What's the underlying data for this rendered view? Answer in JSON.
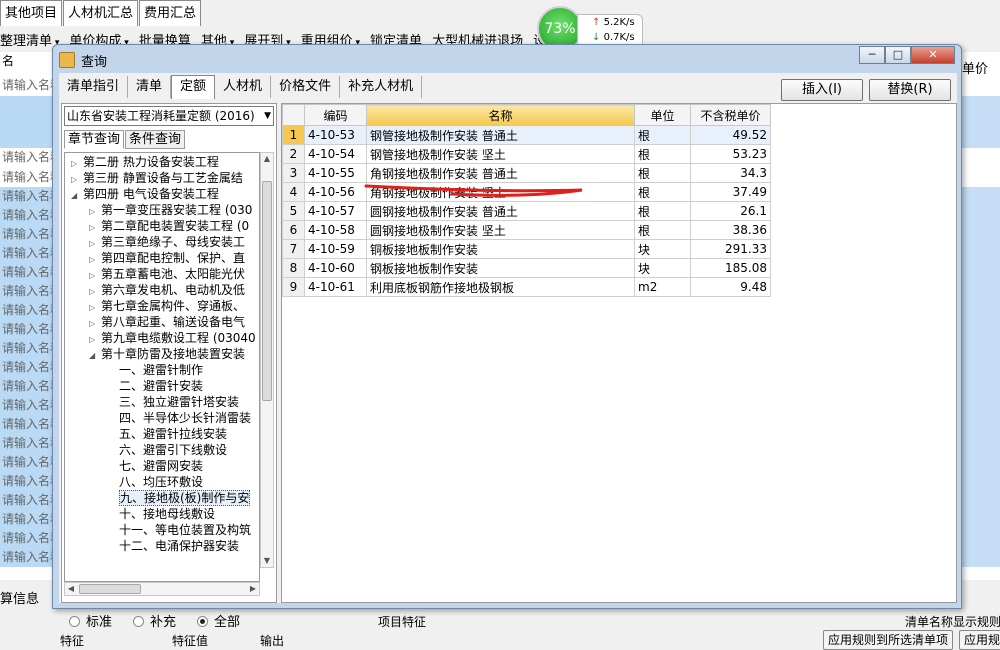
{
  "background": {
    "tabs": [
      "其他项目",
      "人材机汇总",
      "费用汇总"
    ],
    "toolbar": [
      "整理清单",
      "单价构成",
      "批量换算",
      "其他",
      "展开到",
      "重用组价",
      "锁定清单",
      "大型机械进退场",
      "设置"
    ],
    "row_text": "请输入名称",
    "right_header": "单价",
    "bottom_left_label": "算信息",
    "bottom_col_feature": "特征",
    "bottom_col_value": "特征值",
    "bottom_col_output": "输出",
    "bottom_center_label": "项目特征",
    "bottom_right_label": "清单名称显示规则",
    "bottom_btn_apply": "应用规则到所选清单项",
    "bottom_btn_apply2": "应用规则"
  },
  "net_widget": {
    "percent": "73%",
    "up": "5.2K/s",
    "down": "0.7K/s"
  },
  "dialog": {
    "title": "查询",
    "window_buttons": {
      "minimize": "─",
      "maximize": "□",
      "close": "✕"
    },
    "tabs": [
      {
        "label": "清单指引",
        "active": false
      },
      {
        "label": "清单",
        "active": false
      },
      {
        "label": "定额",
        "active": true
      },
      {
        "label": "人材机",
        "active": false
      },
      {
        "label": "价格文件",
        "active": false
      },
      {
        "label": "补充人材机",
        "active": false
      }
    ],
    "insert_button": "插入(I)",
    "replace_button": "替换(R)",
    "quota_library": "山东省安装工程消耗量定额 (2016)",
    "subtabs": [
      "章节查询",
      "条件查询"
    ],
    "tree": [
      {
        "level": 0,
        "toggle": "▷",
        "label": "第二册 热力设备安装工程"
      },
      {
        "level": 0,
        "toggle": "▷",
        "label": "第三册 静置设备与工艺金属结"
      },
      {
        "level": 0,
        "toggle": "◢",
        "label": "第四册 电气设备安装工程"
      },
      {
        "level": 1,
        "toggle": "▷",
        "label": "第一章变压器安装工程 (030"
      },
      {
        "level": 1,
        "toggle": "▷",
        "label": "第二章配电装置安装工程 (0"
      },
      {
        "level": 1,
        "toggle": "▷",
        "label": "第三章绝缘子、母线安装工"
      },
      {
        "level": 1,
        "toggle": "▷",
        "label": "第四章配电控制、保护、直"
      },
      {
        "level": 1,
        "toggle": "▷",
        "label": "第五章蓄电池、太阳能光伏"
      },
      {
        "level": 1,
        "toggle": "▷",
        "label": "第六章发电机、电动机及低"
      },
      {
        "level": 1,
        "toggle": "▷",
        "label": "第七章金属构件、穿通板、"
      },
      {
        "level": 1,
        "toggle": "▷",
        "label": "第八章起重、输送设备电气"
      },
      {
        "level": 1,
        "toggle": "▷",
        "label": "第九章电缆敷设工程 (03040"
      },
      {
        "level": 1,
        "toggle": "◢",
        "label": "第十章防雷及接地装置安装"
      },
      {
        "level": 2,
        "toggle": "",
        "label": "一、避雷针制作"
      },
      {
        "level": 2,
        "toggle": "",
        "label": "二、避雷针安装"
      },
      {
        "level": 2,
        "toggle": "",
        "label": "三、独立避雷针塔安装"
      },
      {
        "level": 2,
        "toggle": "",
        "label": "四、半导体少长针消雷装"
      },
      {
        "level": 2,
        "toggle": "",
        "label": "五、避雷针拉线安装"
      },
      {
        "level": 2,
        "toggle": "",
        "label": "六、避雷引下线敷设"
      },
      {
        "level": 2,
        "toggle": "",
        "label": "七、避雷网安装"
      },
      {
        "level": 2,
        "toggle": "",
        "label": "八、均压环敷设"
      },
      {
        "level": 2,
        "toggle": "",
        "label": "九、接地极(板)制作与安",
        "selected": true
      },
      {
        "level": 2,
        "toggle": "",
        "label": "十、接地母线敷设"
      },
      {
        "level": 2,
        "toggle": "",
        "label": "十一、等电位装置及构筑"
      },
      {
        "level": 2,
        "toggle": "",
        "label": "十二、电涌保护器安装"
      }
    ],
    "radio_options": [
      {
        "label": "标准",
        "checked": false
      },
      {
        "label": "补充",
        "checked": false
      },
      {
        "label": "全部",
        "checked": true
      }
    ],
    "table": {
      "columns": [
        "",
        "编码",
        "名称",
        "单位",
        "不含税单价"
      ],
      "rows": [
        {
          "n": "1",
          "code": "4-10-53",
          "name": "钢管接地极制作安装 普通土",
          "unit": "根",
          "price": "49.52"
        },
        {
          "n": "2",
          "code": "4-10-54",
          "name": "钢管接地极制作安装 坚土",
          "unit": "根",
          "price": "53.23"
        },
        {
          "n": "3",
          "code": "4-10-55",
          "name": "角钢接地极制作安装 普通土",
          "unit": "根",
          "price": "34.3"
        },
        {
          "n": "4",
          "code": "4-10-56",
          "name": "角钢接地极制作安装 坚土",
          "unit": "根",
          "price": "37.49"
        },
        {
          "n": "5",
          "code": "4-10-57",
          "name": "圆钢接地极制作安装 普通土",
          "unit": "根",
          "price": "26.1"
        },
        {
          "n": "6",
          "code": "4-10-58",
          "name": "圆钢接地极制作安装 坚土",
          "unit": "根",
          "price": "38.36"
        },
        {
          "n": "7",
          "code": "4-10-59",
          "name": "铜板接地板制作安装",
          "unit": "块",
          "price": "291.33"
        },
        {
          "n": "8",
          "code": "4-10-60",
          "name": "钢板接地板制作安装",
          "unit": "块",
          "price": "185.08"
        },
        {
          "n": "9",
          "code": "4-10-61",
          "name": "利用底板钢筋作接地极钢板",
          "unit": "m2",
          "price": "9.48"
        }
      ]
    }
  },
  "colors": {
    "accent_header": "#f6c94e",
    "selection": "#e8f1fb",
    "annotation": "#e0201a",
    "dialog_frame": "#c3d5ea"
  }
}
